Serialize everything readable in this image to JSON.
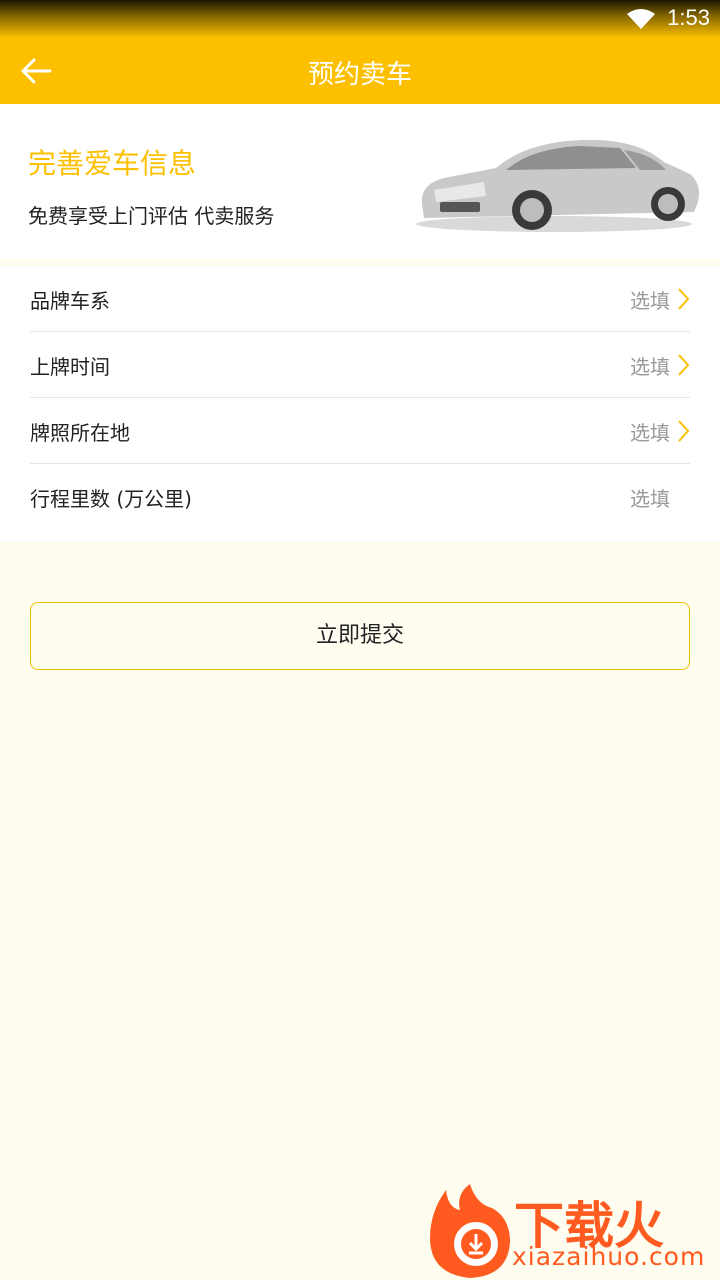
{
  "status_bar": {
    "time": "1:53"
  },
  "app_bar": {
    "title": "预约卖车"
  },
  "banner": {
    "headline": "完善爱车信息",
    "subline": "免费享受上门评估 代卖服务"
  },
  "form": {
    "rows": [
      {
        "label": "品牌车系",
        "value": "选填"
      },
      {
        "label": "上牌时间",
        "value": "选填"
      },
      {
        "label": "牌照所在地",
        "value": "选填"
      },
      {
        "label": "行程里数 (万公里)",
        "value": "选填"
      }
    ]
  },
  "submit_label": "立即提交",
  "watermark": {
    "cn": "下载火",
    "domain": "xiazaihuo.com"
  },
  "colors": {
    "accent": "#fdc000",
    "background": "#fffdf0",
    "watermark": "#ff5a1f"
  }
}
